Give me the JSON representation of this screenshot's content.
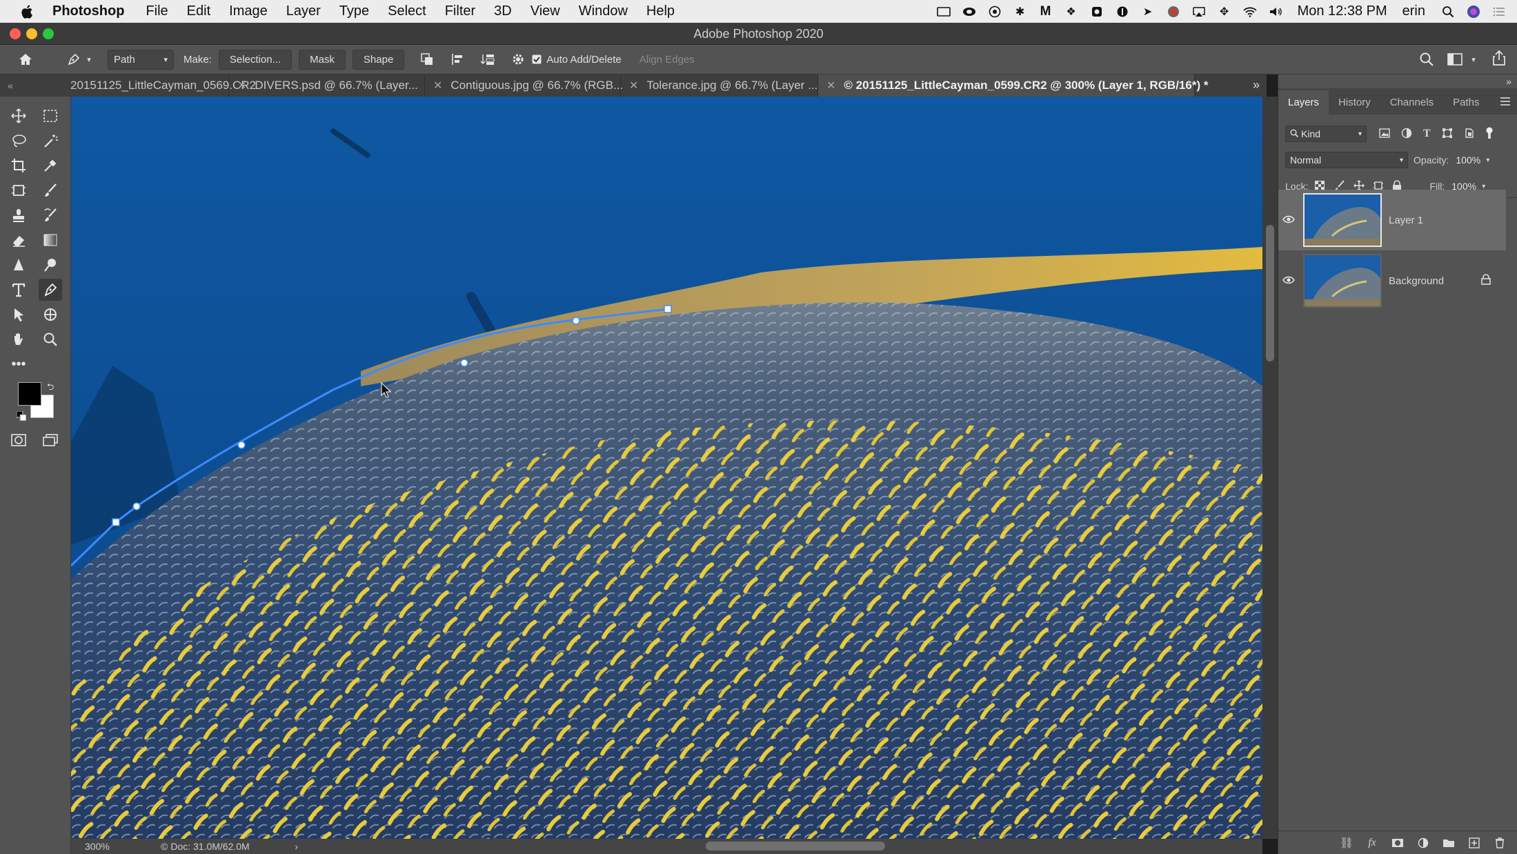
{
  "menubar": {
    "app": "Photoshop",
    "items": [
      "File",
      "Edit",
      "Image",
      "Layer",
      "Type",
      "Select",
      "Filter",
      "3D",
      "View",
      "Window",
      "Help"
    ],
    "clock": "Mon 12:38 PM",
    "user": "erin"
  },
  "window": {
    "title": "Adobe Photoshop 2020"
  },
  "options": {
    "mode": "Path",
    "make_label": "Make:",
    "selection": "Selection...",
    "mask": "Mask",
    "shape": "Shape",
    "auto_add_delete": "Auto Add/Delete",
    "auto_add_delete_checked": true,
    "align_edges": "Align Edges"
  },
  "tabs": [
    {
      "label": "20151125_LittleCayman_0569.CR2"
    },
    {
      "label": "DIVERS.psd @ 66.7% (Layer..."
    },
    {
      "label": "Contiguous.jpg @ 66.7% (RGB..."
    },
    {
      "label": "Tolerance.jpg @ 66.7% (Layer ..."
    },
    {
      "label": "© 20151125_LittleCayman_0599.CR2 @ 300% (Layer 1, RGB/16*) *"
    }
  ],
  "status": {
    "zoom": "300%",
    "doc": "Doc: 31.0M/62.0M"
  },
  "panel": {
    "tabs": [
      "Layers",
      "History",
      "Channels",
      "Paths"
    ],
    "filter_kind": "Kind",
    "blend_mode": "Normal",
    "opacity_label": "Opacity:",
    "opacity": "100%",
    "lock_label": "Lock:",
    "fill_label": "Fill:",
    "fill": "100%",
    "layers": [
      {
        "name": "Layer 1",
        "visible": true,
        "selected": true,
        "locked": false
      },
      {
        "name": "Background",
        "visible": true,
        "selected": false,
        "locked": true
      }
    ]
  },
  "colors": {
    "foreground": "#000000",
    "background": "#ffffff",
    "accent": "#3d8bff",
    "water": "#0f4f91",
    "fish_body": "#2f4b72",
    "fish_fin": "#d6b45a"
  }
}
